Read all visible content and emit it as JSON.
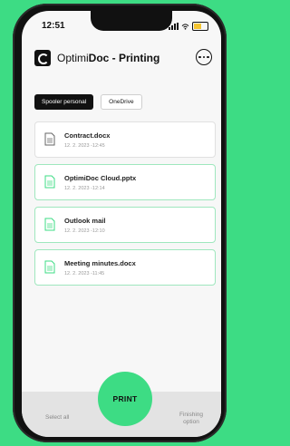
{
  "status_bar": {
    "time": "12:51"
  },
  "header": {
    "brand_regular": "Optimi",
    "brand_bold": "Doc",
    "title_suffix": " - Printing"
  },
  "tabs": [
    {
      "label": "Spooler personal",
      "active": true
    },
    {
      "label": "OneDrive",
      "active": false
    }
  ],
  "documents": [
    {
      "name": "Contract.docx",
      "date": "12. 2. 2023 -12:45"
    },
    {
      "name": "OptimiDoc Cloud.pptx",
      "date": "12. 2. 2023 -12:14"
    },
    {
      "name": "Outlook mail",
      "date": "12. 2. 2023 -12:10"
    },
    {
      "name": "Meeting minutes.docx",
      "date": "12. 2. 2023 -11:45"
    }
  ],
  "bottom_bar": {
    "select_all": "Select all",
    "print": "PRINT",
    "finishing_option_line1": "Finishing",
    "finishing_option_line2": "option"
  },
  "colors": {
    "accent": "#3ddc84",
    "dark": "#111111"
  }
}
